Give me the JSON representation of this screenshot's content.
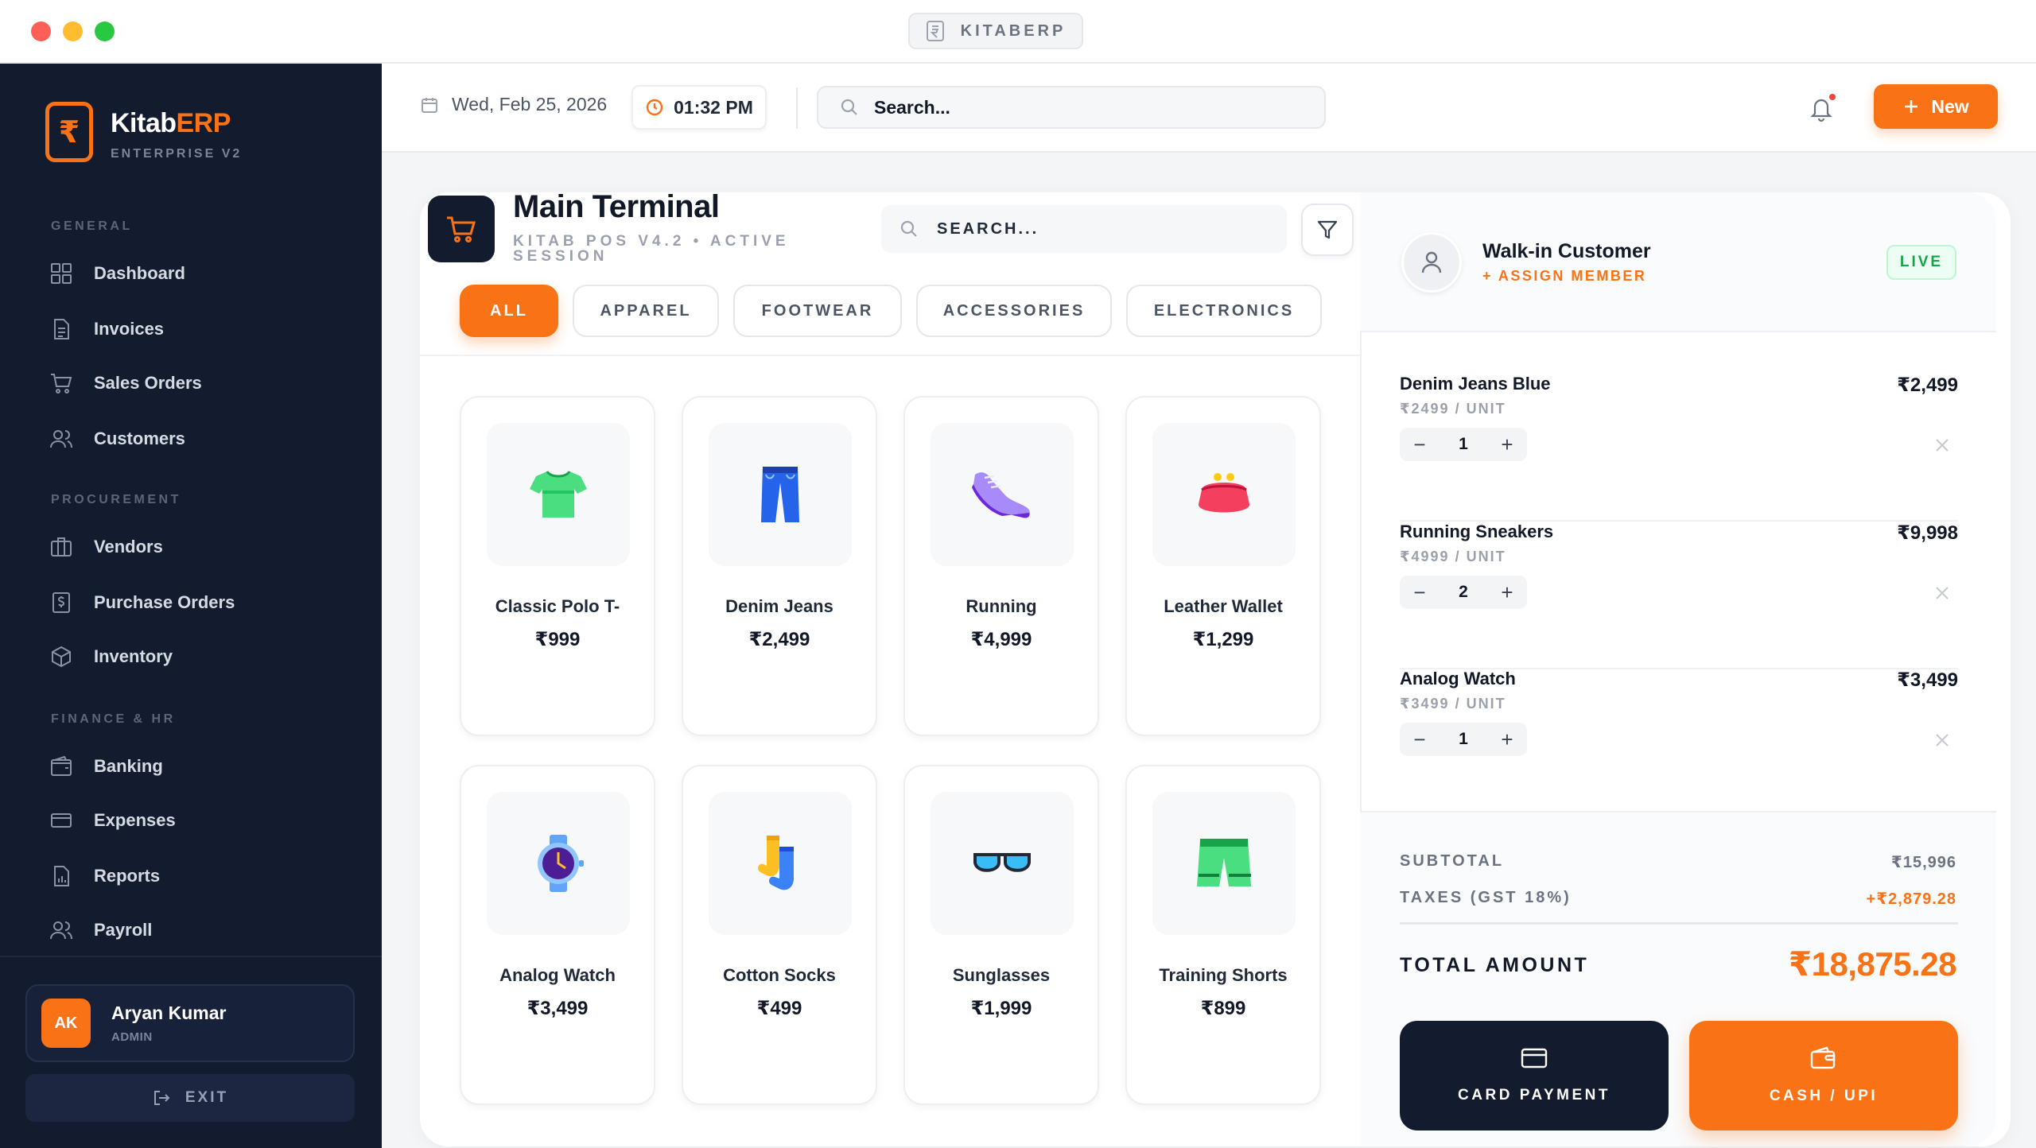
{
  "window": {
    "title": "KITABERP"
  },
  "brand": {
    "name_main": "Kitab",
    "name_accent": "ERP",
    "subtitle": "ENTERPRISE V2",
    "logo_glyph": "₹"
  },
  "sidebar": {
    "sections": [
      {
        "label": "GENERAL"
      },
      {
        "label": "PROCUREMENT"
      },
      {
        "label": "FINANCE & HR"
      }
    ],
    "items": [
      {
        "label": "Dashboard",
        "icon": "grid-icon"
      },
      {
        "label": "Invoices",
        "icon": "document-icon"
      },
      {
        "label": "Sales Orders",
        "icon": "cart-icon"
      },
      {
        "label": "Customers",
        "icon": "users-icon"
      },
      {
        "label": "Vendors",
        "icon": "briefcase-icon"
      },
      {
        "label": "Purchase Orders",
        "icon": "receipt-icon"
      },
      {
        "label": "Inventory",
        "icon": "box-icon"
      },
      {
        "label": "Banking",
        "icon": "wallet-icon"
      },
      {
        "label": "Expenses",
        "icon": "credit-card-icon"
      },
      {
        "label": "Reports",
        "icon": "report-icon"
      },
      {
        "label": "Payroll",
        "icon": "users-icon"
      }
    ],
    "user": {
      "initials": "AK",
      "name": "Aryan Kumar",
      "role": "ADMIN"
    },
    "exit_label": "EXIT"
  },
  "topbar": {
    "date": "Wed, Feb 25, 2026",
    "time": "01:32 PM",
    "search_placeholder": "Search...",
    "new_label": "New"
  },
  "terminal": {
    "title": "Main Terminal",
    "subtitle": "KITAB POS V4.2 • ACTIVE SESSION",
    "search_placeholder": "SEARCH...",
    "categories": [
      "ALL",
      "APPAREL",
      "FOOTWEAR",
      "ACCESSORIES",
      "ELECTRONICS"
    ],
    "active_category": "ALL",
    "products": [
      {
        "name": "Classic Polo T-",
        "price": "₹999",
        "icon": "tshirt-icon"
      },
      {
        "name": "Denim Jeans",
        "price": "₹2,499",
        "icon": "jeans-icon"
      },
      {
        "name": "Running",
        "price": "₹4,999",
        "icon": "sneaker-icon"
      },
      {
        "name": "Leather Wallet",
        "price": "₹1,299",
        "icon": "purse-icon"
      },
      {
        "name": "Analog Watch",
        "price": "₹3,499",
        "icon": "watch-icon"
      },
      {
        "name": "Cotton Socks",
        "price": "₹499",
        "icon": "socks-icon"
      },
      {
        "name": "Sunglasses",
        "price": "₹1,999",
        "icon": "sunglasses-icon"
      },
      {
        "name": "Training Shorts",
        "price": "₹899",
        "icon": "shorts-icon"
      }
    ]
  },
  "cart": {
    "customer": "Walk-in Customer",
    "assign_label": "+ ASSIGN MEMBER",
    "live_label": "LIVE",
    "items": [
      {
        "name": "Denim Jeans Blue",
        "unit": "₹2499 / UNIT",
        "qty": "1",
        "total": "₹2,499"
      },
      {
        "name": "Running Sneakers",
        "unit": "₹4999 / UNIT",
        "qty": "2",
        "total": "₹9,998"
      },
      {
        "name": "Analog Watch",
        "unit": "₹3499 / UNIT",
        "qty": "1",
        "total": "₹3,499"
      }
    ],
    "subtotal_label": "SUBTOTAL",
    "subtotal": "₹15,996",
    "tax_label": "TAXES (GST 18%)",
    "tax": "+₹2,879.28",
    "total_label": "TOTAL AMOUNT",
    "total": "₹18,875.28",
    "card_label": "CARD PAYMENT",
    "cash_label": "CASH / UPI"
  },
  "colors": {
    "accent": "#f97316",
    "sidebar": "#131b2e",
    "live": "#16a34a"
  }
}
